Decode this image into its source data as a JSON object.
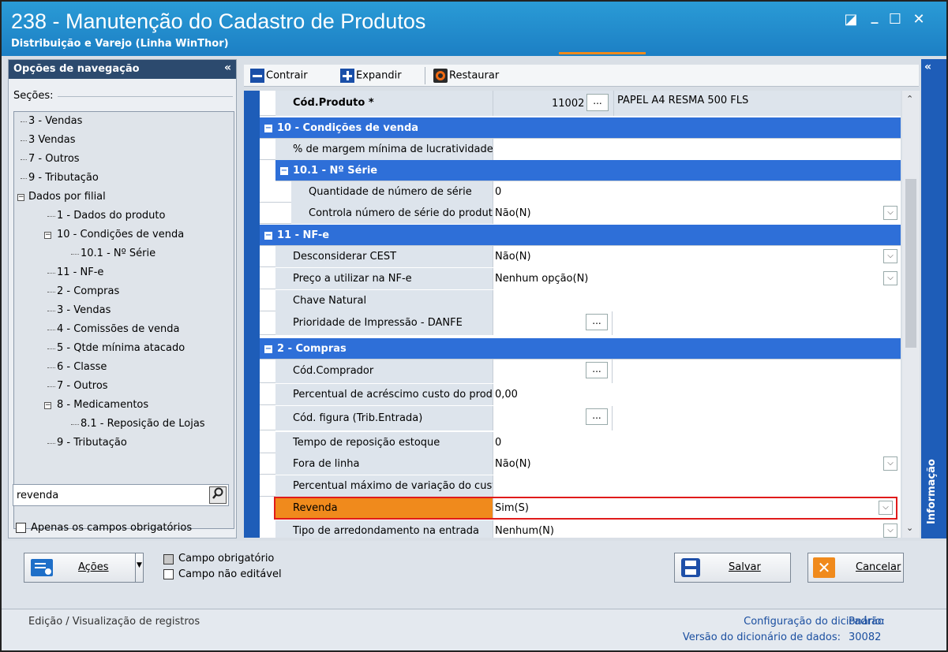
{
  "window": {
    "title": "238 - Manutenção do Cadastro de Produtos",
    "subtitle": "Distribuição e Varejo (Linha WinThor)",
    "controls": [
      "◪",
      "_",
      "☐",
      "✕"
    ]
  },
  "nav": {
    "header": "Opções de navegação",
    "collapse": "«",
    "sections_label": "Seções:",
    "tree": [
      {
        "label": "3 - Vendas"
      },
      {
        "label": "3 Vendas"
      },
      {
        "label": "7 - Outros"
      },
      {
        "label": "9 - Tributação"
      },
      {
        "label": "Dados por filial"
      },
      {
        "label": "1 - Dados do produto"
      },
      {
        "label": "10 - Condições de venda"
      },
      {
        "label": "10.1 - Nº Série"
      },
      {
        "label": "11 - NF-e"
      },
      {
        "label": "2 - Compras"
      },
      {
        "label": "3 - Vendas"
      },
      {
        "label": "4 - Comissões de venda"
      },
      {
        "label": "5 - Qtde mínima atacado"
      },
      {
        "label": "6 - Classe"
      },
      {
        "label": "7 - Outros"
      },
      {
        "label": "8 - Medicamentos"
      },
      {
        "label": "8.1 -  Reposição de Lojas"
      },
      {
        "label": "9 - Tributação"
      }
    ],
    "search_value": "revenda",
    "only_required_label": "Apenas os campos obrigatórios"
  },
  "toolbar": {
    "collapse_label": "Contrair",
    "expand_label": "Expandir",
    "restore_label": "Restaurar"
  },
  "grid": {
    "product_label": "Cód.Produto *",
    "product_code": "11002",
    "product_desc": "PAPEL A4 RESMA 500 FLS",
    "sec10": "10 - Condições de venda",
    "margem_label": "% de margem mínima de lucratividade",
    "sec101": "10.1 - Nº Série",
    "qtd_serie_label": "Quantidade de número de série",
    "qtd_serie_value": "0",
    "ctrl_serie_label": "Controla número de série do produto",
    "ctrl_serie_value": "Não(N)",
    "sec11": "11 - NF-e",
    "cest_label": "Desconsiderar CEST",
    "cest_value": "Não(N)",
    "preco_nfe_label": "Preço a utilizar na NF-e",
    "preco_nfe_value": "Nenhum opção(N)",
    "chave_label": "Chave Natural",
    "prioridade_label": "Prioridade de Impressão - DANFE",
    "sec2": "2 - Compras",
    "comprador_label": "Cód.Comprador",
    "perc_acresc_label": "Percentual de acréscimo custo do produto",
    "perc_acresc_value": "0,00",
    "cod_figura_label": "Cód. figura (Trib.Entrada)",
    "tempo_rep_label": "Tempo de reposição estoque",
    "tempo_rep_value": "0",
    "fora_linha_label": "Fora de linha",
    "fora_linha_value": "Não(N)",
    "perc_max_label": "Percentual máximo de variação do custo",
    "revenda_label": "Revenda",
    "revenda_value": "Sim(S)",
    "arred_label": "Tipo de arredondamento na entrada",
    "arred_value": "Nenhum(N)",
    "ellipsis": "...",
    "dropdown": "⌵"
  },
  "side_panel": {
    "label": "Informação",
    "collapse": "«"
  },
  "footer": {
    "acoes_label": "Ações",
    "legend_required": "Campo obrigatório",
    "legend_readonly": "Campo não editável",
    "save_label": "Salvar",
    "cancel_label": "Cancelar"
  },
  "status": {
    "left": "Edição / Visualização de registros",
    "dict_config_label": "Configuração do dicionário:",
    "dict_config_value": "Padrão",
    "dict_version_label": "Versão do dicionário de dados:",
    "dict_version_value": "30082"
  },
  "colors": {
    "titlebar": "#1c7fc4",
    "section": "#2e6fd8",
    "highlight": "#f08a1c",
    "highlight_border": "#e01b1b"
  }
}
